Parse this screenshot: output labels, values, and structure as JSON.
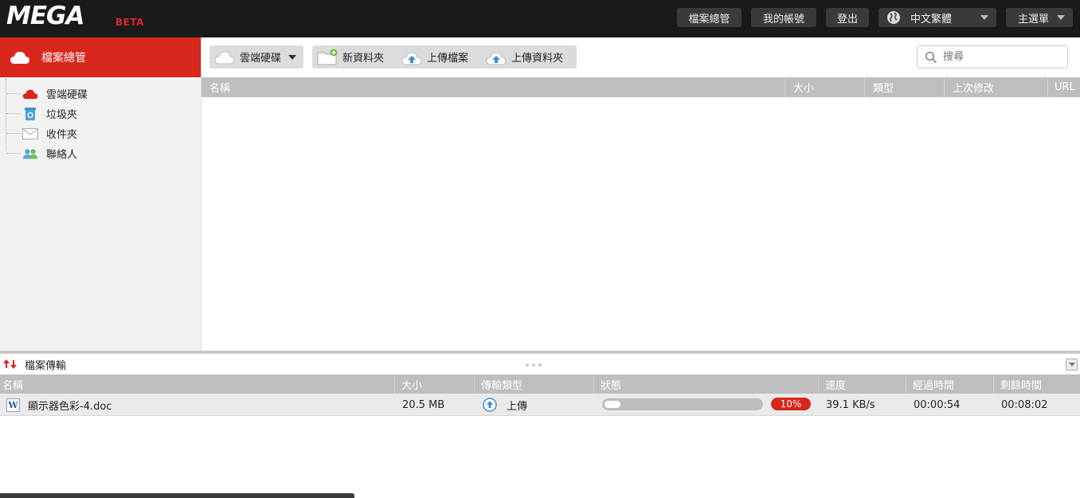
{
  "brand": {
    "logo": "MEGA",
    "badge": "BETA"
  },
  "topnav": {
    "file_manager": "檔案總管",
    "my_account": "我的帳號",
    "logout": "登出",
    "language": "中文繁體",
    "main_menu": "主選單"
  },
  "sidebar": {
    "header": "檔案總管",
    "items": [
      {
        "label": "雲端硬碟",
        "icon": "cloud-icon"
      },
      {
        "label": "垃圾夾",
        "icon": "recycle-bin-icon"
      },
      {
        "label": "收件夾",
        "icon": "envelope-icon"
      },
      {
        "label": "聯絡人",
        "icon": "contacts-icon"
      }
    ]
  },
  "toolbar": {
    "location": "雲端硬碟",
    "new_folder": "新資料夾",
    "upload_file": "上傳檔案",
    "upload_folder": "上傳資料夾",
    "search_placeholder": "搜尋"
  },
  "file_table": {
    "columns": [
      "名稱",
      "大小",
      "類型",
      "上次修改",
      "URL"
    ]
  },
  "transfers": {
    "title": "檔案傳輸",
    "columns": [
      "名稱",
      "大小",
      "傳輸類型",
      "狀態",
      "速度",
      "經過時間",
      "剩餘時間"
    ],
    "rows": [
      {
        "name": "顯示器色彩-4.doc",
        "size": "20.5 MB",
        "type": "上傳",
        "progress_percent": 10,
        "progress_label": "10%",
        "speed": "39.1 KB/s",
        "elapsed": "00:00:54",
        "remaining": "00:08:02"
      }
    ]
  },
  "colors": {
    "accent": "#d9261c",
    "topbar": "#1a1a1a",
    "header_gray": "#bebebe"
  }
}
